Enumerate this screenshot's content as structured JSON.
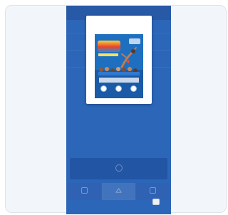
{
  "app": {
    "header_text": "",
    "overlay_button_label": "",
    "bottom_link_label": ""
  },
  "modal": {
    "title": "",
    "description": ""
  },
  "icons": {
    "phone_card": "circle-icon",
    "tile_1": "square-icon",
    "tile_2": "triangle-icon",
    "tile_3": "square-icon",
    "flyer_badges": [
      "circle-icon",
      "circle-icon",
      "circle-icon"
    ]
  },
  "colors": {
    "page_background": "#f2f5f9",
    "phone_background": "#2c66b8",
    "header_background": "#2859a6",
    "active_tile": "#4274bd",
    "flyer_blue": "#1e6fc0"
  }
}
